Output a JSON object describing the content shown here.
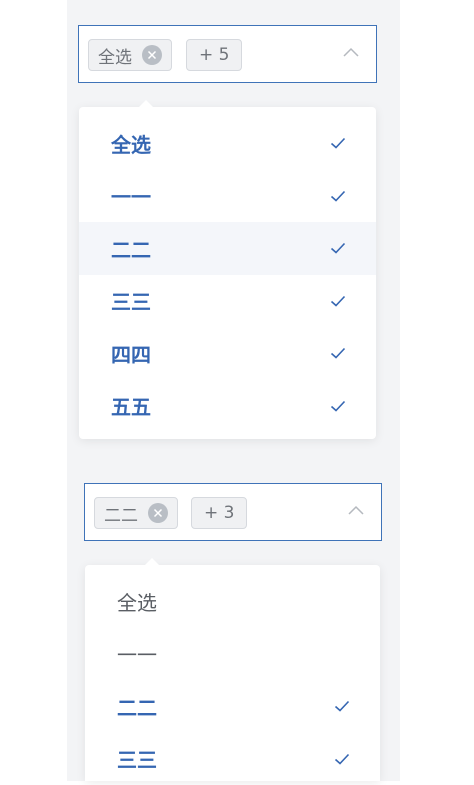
{
  "select1": {
    "tag_label": "全选",
    "overflow_count": "+ 5",
    "options": [
      {
        "label": "全选",
        "selected": true
      },
      {
        "label": "一一",
        "selected": true
      },
      {
        "label": "二二",
        "selected": true,
        "hovered": true
      },
      {
        "label": "三三",
        "selected": true
      },
      {
        "label": "四四",
        "selected": true
      },
      {
        "label": "五五",
        "selected": true
      }
    ]
  },
  "select2": {
    "tag_label": "二二",
    "overflow_count": "+ 3",
    "options": [
      {
        "label": "全选",
        "selected": false
      },
      {
        "label": "一一",
        "selected": false
      },
      {
        "label": "二二",
        "selected": true
      },
      {
        "label": "三三",
        "selected": true
      }
    ]
  },
  "colors": {
    "accent": "#3566b2",
    "border_active": "#3f73b8",
    "tag_bg": "#f0f1f3",
    "page_bg": "#f3f4f6"
  },
  "icons": {
    "clear": "close-circle-icon",
    "arrow": "chevron-up-icon",
    "check": "check-icon"
  }
}
